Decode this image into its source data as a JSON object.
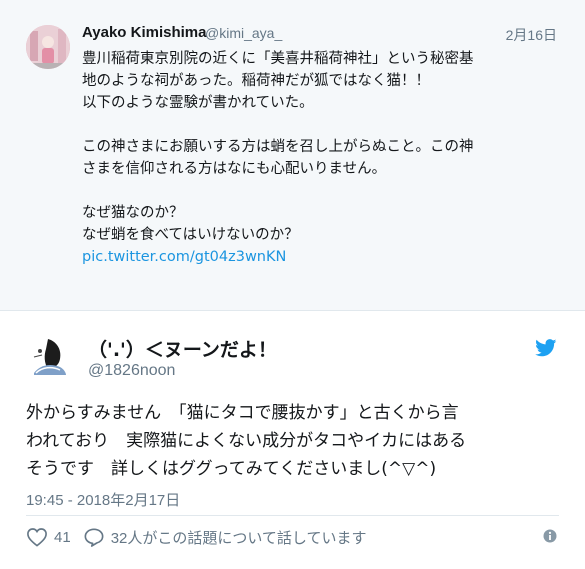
{
  "quoted_tweet": {
    "author_name": "Ayako Kimishima",
    "author_handle": "@kimi_aya_",
    "date": "2月16日",
    "lines": [
      "豊川稲荷東京別院の近くに「美喜井稲荷神社」という秘密基",
      "地のような祠があった。稲荷神だが狐ではなく猫！！",
      "以下のような霊験が書かれていた。",
      "",
      "この神さまにお願いする方は蛸を召し上がらぬこと。この神",
      "さまを信仰される方はなにも心配いりません。",
      "",
      "なぜ猫なのか？",
      "なぜ蛸を食べてはいけないのか？"
    ],
    "link": "pic.twitter.com/gt04z3wnKN"
  },
  "tweet": {
    "author_name": "（'.'）＜ヌーンだよ！",
    "author_handle": "@1826noon",
    "lines": [
      "外からすみません　「猫にタコで腰抜かす」と古くから言",
      "われており　実際猫によくない成分がタコやイカにはある",
      "そうです　詳しくはググってみてくださいまし(^▽^)"
    ],
    "timestamp": "19:45 - 2018年2月17日",
    "likes": "41",
    "conversation": "32人がこの話題について話しています"
  },
  "colors": {
    "twitter_blue": "#1da1f2",
    "link": "#1b95e0",
    "secondary_text": "#657786",
    "quoted_bg": "#f5f8fa"
  },
  "icons": {
    "brand": "twitter-bird-icon",
    "like": "heart-icon",
    "reply": "speech-bubble-icon",
    "info": "info-icon"
  }
}
